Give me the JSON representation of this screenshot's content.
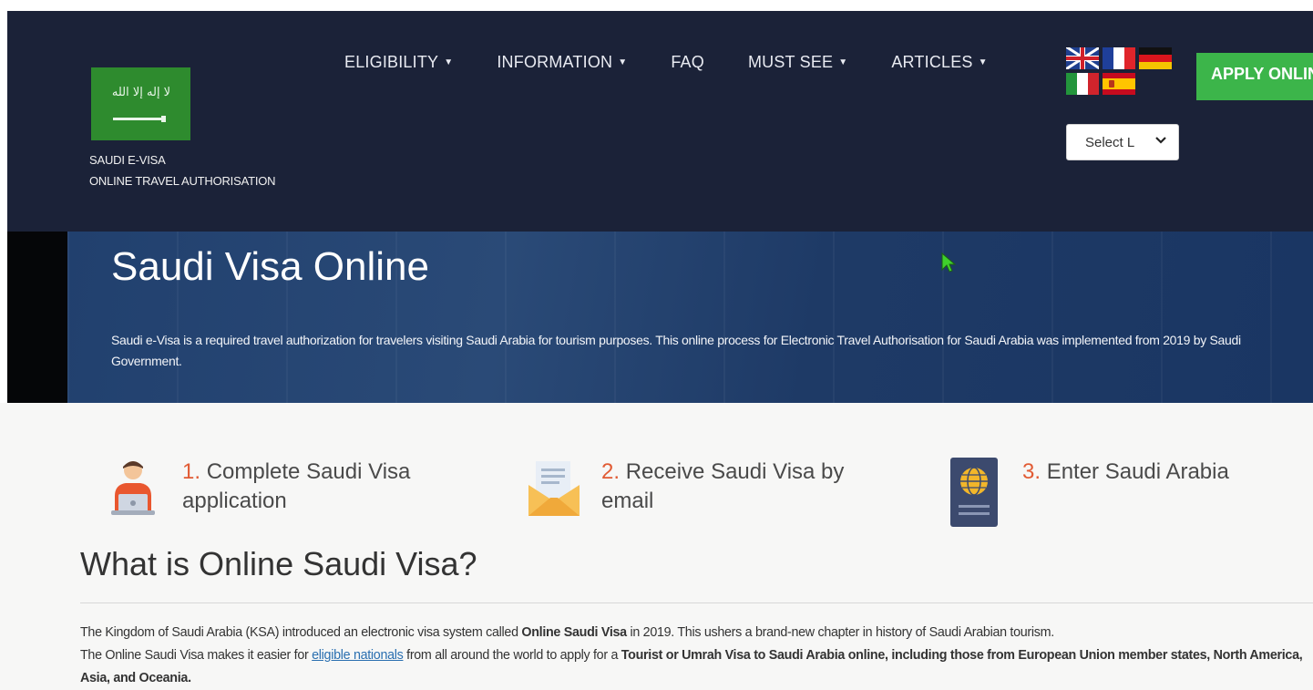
{
  "header": {
    "brand_line1": "SAUDI E-VISA",
    "brand_line2": "ONLINE TRAVEL AUTHORISATION",
    "logo_script": "لا إله إلا الله",
    "nav": [
      {
        "label": "ELIGIBILITY",
        "has_caret": true
      },
      {
        "label": "INFORMATION",
        "has_caret": true
      },
      {
        "label": "FAQ",
        "has_caret": false
      },
      {
        "label": "MUST SEE",
        "has_caret": true
      },
      {
        "label": "ARTICLES",
        "has_caret": true
      }
    ],
    "caret": "▼",
    "languages": [
      "English",
      "French",
      "German",
      "Italian",
      "Spanish"
    ],
    "language_select": "Select L",
    "apply_button": "APPLY ONLINE"
  },
  "hero": {
    "title": "Saudi Visa Online",
    "description": "Saudi e-Visa is a required travel authorization for travelers visiting Saudi Arabia for tourism purposes. This online process for Electronic Travel Authorisation for Saudi Arabia was implemented from 2019 by Saudi Government."
  },
  "steps": [
    {
      "number": "1.",
      "label": "Complete Saudi Visa application",
      "icon": "person-laptop-icon"
    },
    {
      "number": "2.",
      "label": "Receive Saudi Visa by email",
      "icon": "envelope-icon"
    },
    {
      "number": "3.",
      "label": "Enter Saudi Arabia",
      "icon": "passport-icon"
    }
  ],
  "section": {
    "title": "What is Online Saudi Visa?",
    "p1_a": "The Kingdom of Saudi Arabia (KSA) introduced an electronic visa system called ",
    "p1_b": "Online Saudi Visa",
    "p1_c": " in 2019. This ushers a brand-new chapter in history of Saudi Arabian tourism.",
    "p2_a": "The Online Saudi Visa makes it easier for ",
    "p2_link": "eligible nationals",
    "p2_b": " from all around the world to apply for a ",
    "p2_c": "Tourist or Umrah Visa to Saudi Arabia online, including those from European Union member states, North America, Asia, and Oceania."
  },
  "colors": {
    "header_bg": "#1b2238",
    "apply_green": "#3cb54a",
    "step_number": "#e15b34",
    "link": "#2a6fb0"
  }
}
